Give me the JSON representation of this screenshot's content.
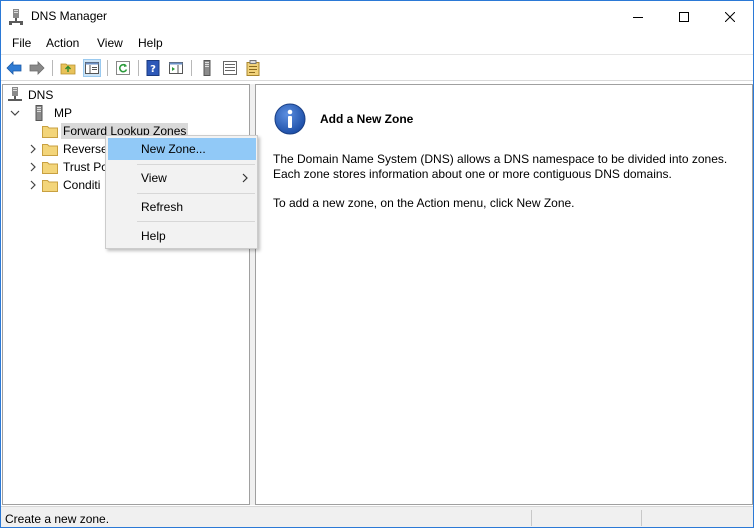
{
  "window": {
    "title": "DNS Manager",
    "accent_color": "#2b79d6"
  },
  "menubar": {
    "items": [
      "File",
      "Action",
      "View",
      "Help"
    ]
  },
  "toolbar": {
    "icons": [
      "back-arrow-icon",
      "forward-arrow-icon",
      "up-folder-icon",
      "show-hide-tree-icon",
      "refresh-icon",
      "help-book-icon",
      "action-pane-icon",
      "server-icon",
      "list-view-icon",
      "properties-icon"
    ]
  },
  "tree": {
    "root": "DNS",
    "server": "MP",
    "nodes": [
      "Forward Lookup Zones",
      "Reverse",
      "Trust Po",
      "Conditi"
    ]
  },
  "context_menu": {
    "items": [
      {
        "label": "New Zone...",
        "highlighted": true
      },
      {
        "label": "View",
        "submenu": true
      },
      {
        "label": "Refresh"
      },
      {
        "label": "Help"
      }
    ]
  },
  "content": {
    "heading": "Add a New Zone",
    "para1_line1": "The Domain Name System (DNS) allows a DNS namespace to be divided into zones.",
    "para1_line2": "Each zone stores information about one or more contiguous DNS domains.",
    "para2": "To add a new zone, on the Action menu, click New Zone."
  },
  "statusbar": {
    "text": "Create a new zone."
  }
}
